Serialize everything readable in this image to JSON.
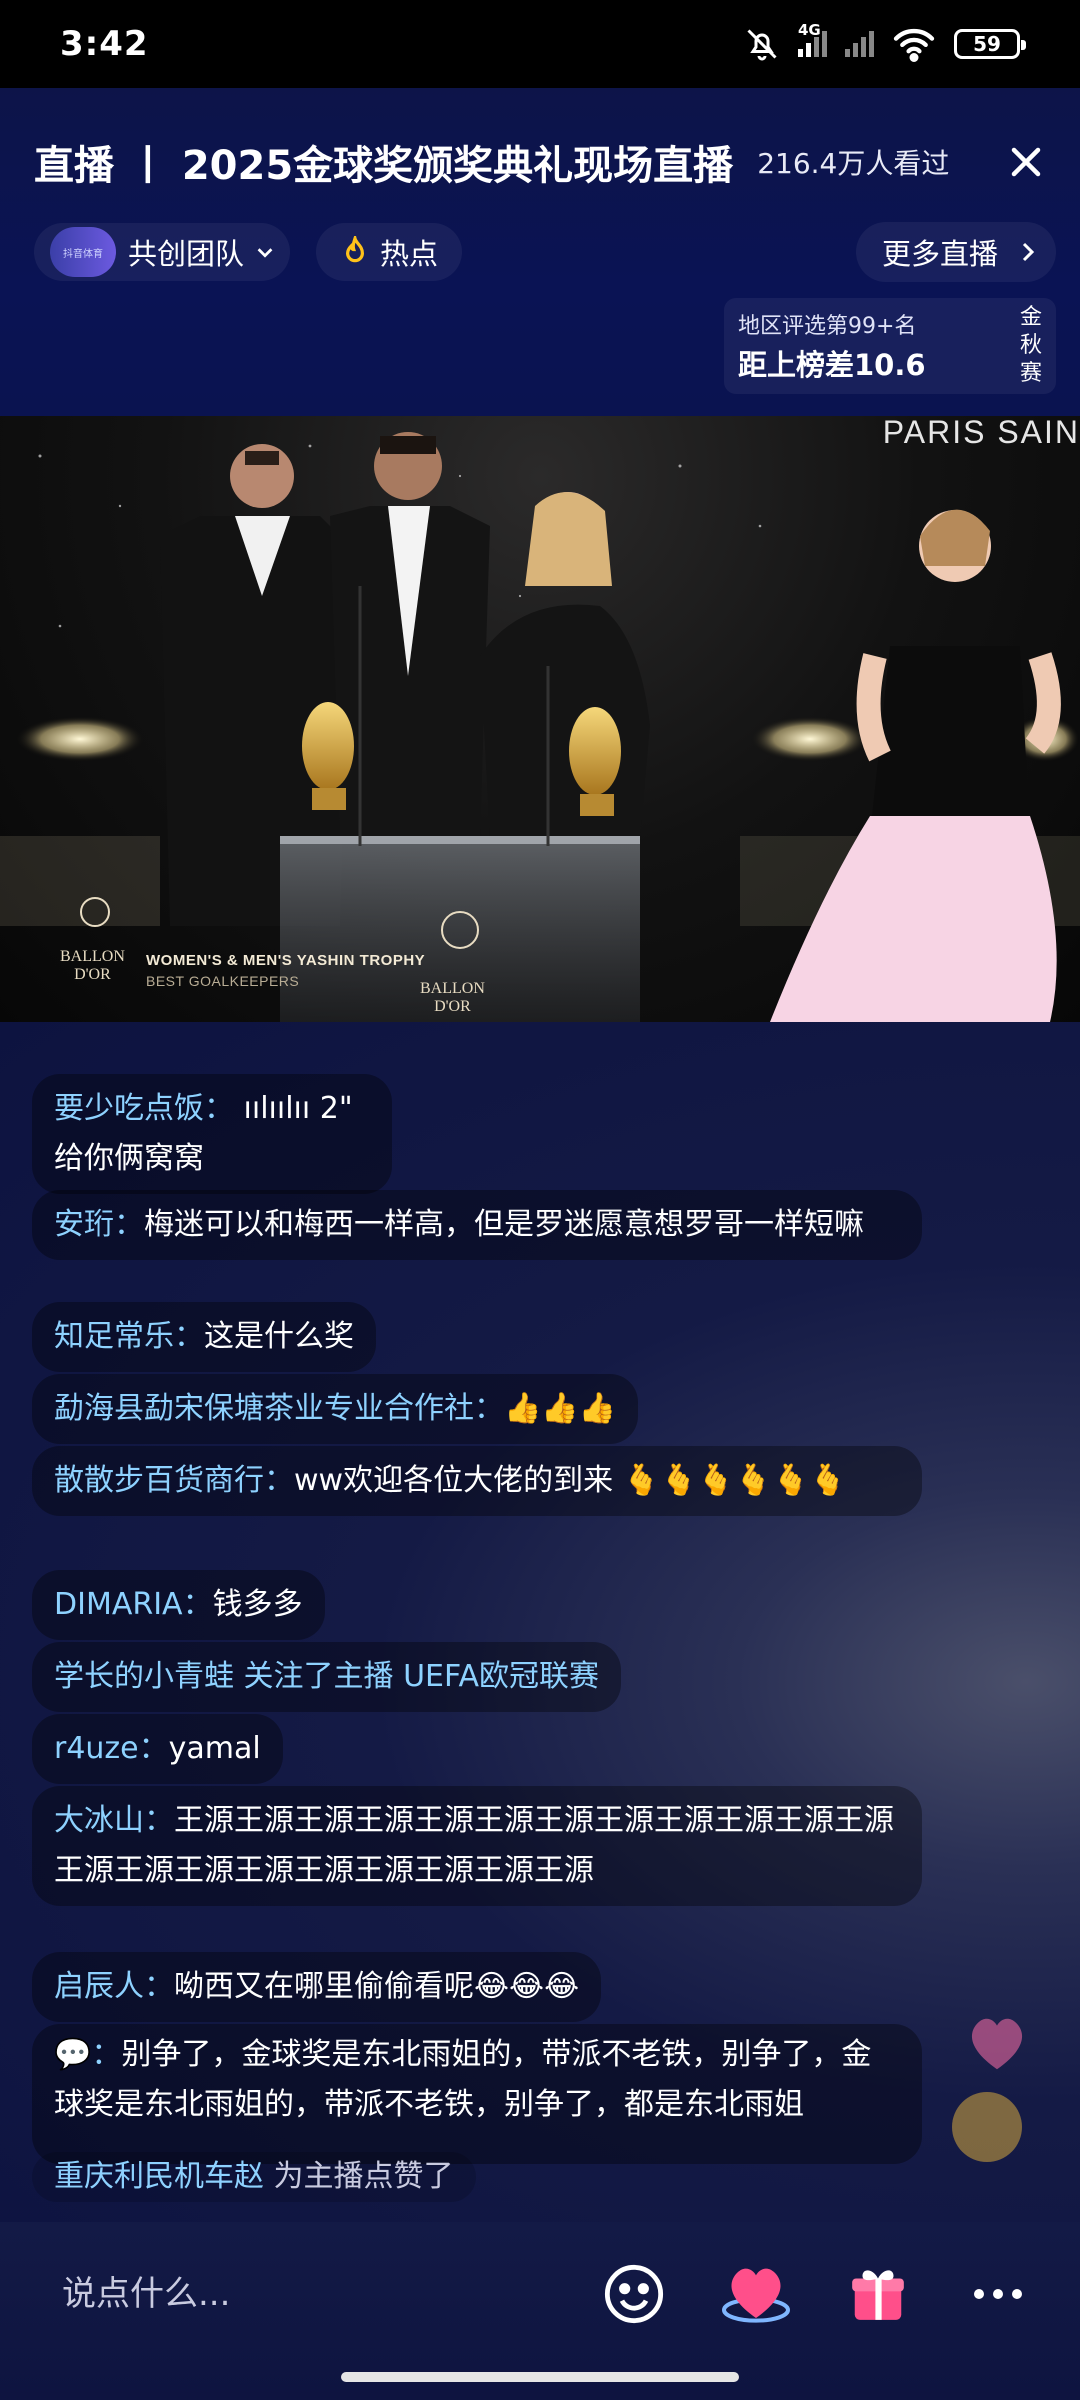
{
  "status_bar": {
    "time": "3:42",
    "network": "4G",
    "battery": "59"
  },
  "header": {
    "title": "直播 丨 2025金球奖颁奖典礼现场直播",
    "viewers": "216.4万人看过",
    "team_name": "共创团队",
    "team_avatar_text": "抖音体育",
    "hot_label": "热点",
    "more_live_label": "更多直播",
    "rank_line1": "地区评选第99+名",
    "rank_line2": "距上榜差10.6",
    "rank_tag": "金秋赛"
  },
  "video": {
    "sign_text": "PARIS SAIN",
    "logo_text_1": "BALLON",
    "logo_text_2": "D'OR",
    "caption_title": "WOMEN'S & MEN'S YASHIN TROPHY",
    "caption_sub": "BEST GOALKEEPERS"
  },
  "chat": {
    "voice_duration": "2\"",
    "messages": [
      {
        "name": "要少吃点饭：",
        "text": "给你俩窝窝"
      },
      {
        "name": "安珩：",
        "text": "梅迷可以和梅西一样高，但是罗迷愿意想罗哥一样短嘛"
      },
      {
        "name": "知足常乐：",
        "text": "这是什么奖"
      },
      {
        "name": "勐海县勐宋保塘茶业专业合作社：",
        "text": "👍👍👍"
      },
      {
        "name": "散散步百货商行：",
        "text": "ww欢迎各位大佬的到来 🫰🫰🫰🫰🫰🫰"
      },
      {
        "name": "DIMARIA：",
        "text": "钱多多"
      },
      {
        "name": "学长的小青蛙 关注了主播 UEFA欧冠联赛",
        "text": ""
      },
      {
        "name": "r4uze：",
        "text": "yamal"
      },
      {
        "name": "大冰山：",
        "text": "王源王源王源王源王源王源王源王源王源王源王源王源王源王源王源王源王源王源王源王源王源"
      },
      {
        "name": "启辰人：",
        "text": "呦西又在哪里偷偷看呢😂😂😂"
      },
      {
        "name": "💬：",
        "text": "别争了，金球奖是东北雨姐的，带派不老铁，别争了，金球奖是东北雨姐的，带派不老铁，别争了，都是东北雨姐"
      },
      {
        "name": "重庆利民机车赵",
        "text": "为主播点赞了"
      }
    ]
  },
  "bottom_bar": {
    "input_placeholder": "说点什么..."
  },
  "colors": {
    "accent_name": "#8ed2ff",
    "header_bg": "#0d1449",
    "gift_pink": "#ff4f8a"
  }
}
